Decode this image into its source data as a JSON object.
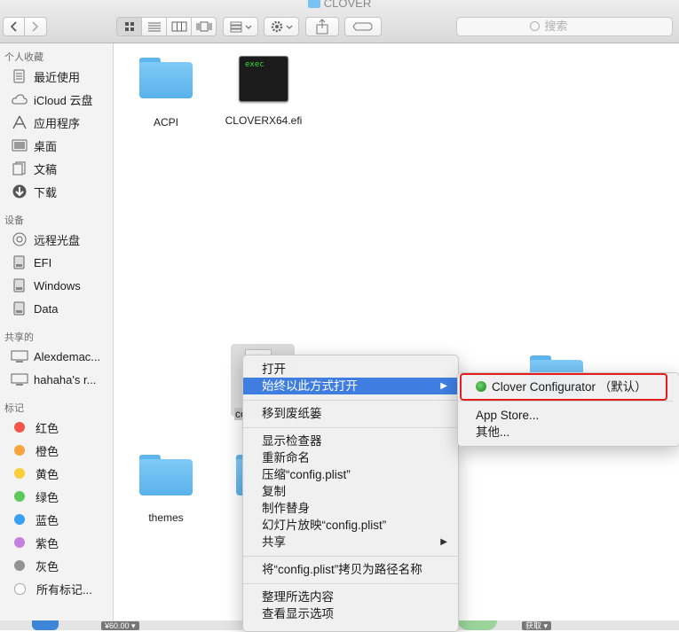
{
  "window": {
    "title": "CLOVER"
  },
  "toolbar": {
    "search_placeholder": "搜索"
  },
  "sidebar": {
    "favorites_header": "个人收藏",
    "favorites": [
      {
        "label": "最近使用",
        "icon": "recents-icon"
      },
      {
        "label": "iCloud 云盘",
        "icon": "icloud-icon"
      },
      {
        "label": "应用程序",
        "icon": "applications-icon"
      },
      {
        "label": "桌面",
        "icon": "desktop-icon"
      },
      {
        "label": "文稿",
        "icon": "documents-icon"
      },
      {
        "label": "下载",
        "icon": "downloads-icon"
      }
    ],
    "devices_header": "设备",
    "devices": [
      {
        "label": "远程光盘",
        "icon": "remote-disc-icon"
      },
      {
        "label": "EFI",
        "icon": "disk-icon"
      },
      {
        "label": "Windows",
        "icon": "disk-icon"
      },
      {
        "label": "Data",
        "icon": "disk-icon"
      }
    ],
    "shared_header": "共享的",
    "shared": [
      {
        "label": "Alexdemac...",
        "icon": "computer-icon"
      },
      {
        "label": "hahaha's r...",
        "icon": "computer-icon"
      }
    ],
    "tags_header": "标记",
    "tags": [
      {
        "label": "红色",
        "color": "#f5544d"
      },
      {
        "label": "橙色",
        "color": "#f6a43b"
      },
      {
        "label": "黄色",
        "color": "#f9ce3b"
      },
      {
        "label": "绿色",
        "color": "#5bc85a"
      },
      {
        "label": "蓝色",
        "color": "#3aa0f3"
      },
      {
        "label": "紫色",
        "color": "#c57fe0"
      },
      {
        "label": "灰色",
        "color": "#939393"
      }
    ],
    "all_tags": "所有标记..."
  },
  "files": {
    "acpi": "ACPI",
    "cloverx64": "CLOVERX64.efi",
    "exec_label": "exec",
    "themes": "themes",
    "config_partial": "co"
  },
  "dock_partial": {
    "price": "¥60.00",
    "get": "获取"
  },
  "context_menu": {
    "open": "打开",
    "open_with": "始终以此方式打开",
    "trash": "移到废纸篓",
    "get_info": "显示检查器",
    "rename": "重新命名",
    "compress": "压缩“config.plist”",
    "duplicate": "复制",
    "make_alias": "制作替身",
    "quick_look": "幻灯片放映“config.plist”",
    "share": "共享",
    "copy_path": "将“config.plist”拷贝为路径名称",
    "clean_up": "整理所选内容",
    "view_options": "查看显示选项"
  },
  "open_with_submenu": {
    "default_app": "Clover Configurator （默认）",
    "app_store": "App Store...",
    "other": "其他..."
  },
  "colors": {
    "highlight": "#3f7ee0",
    "annotation": "#e41e1e",
    "folder": "#6ec0f6"
  }
}
